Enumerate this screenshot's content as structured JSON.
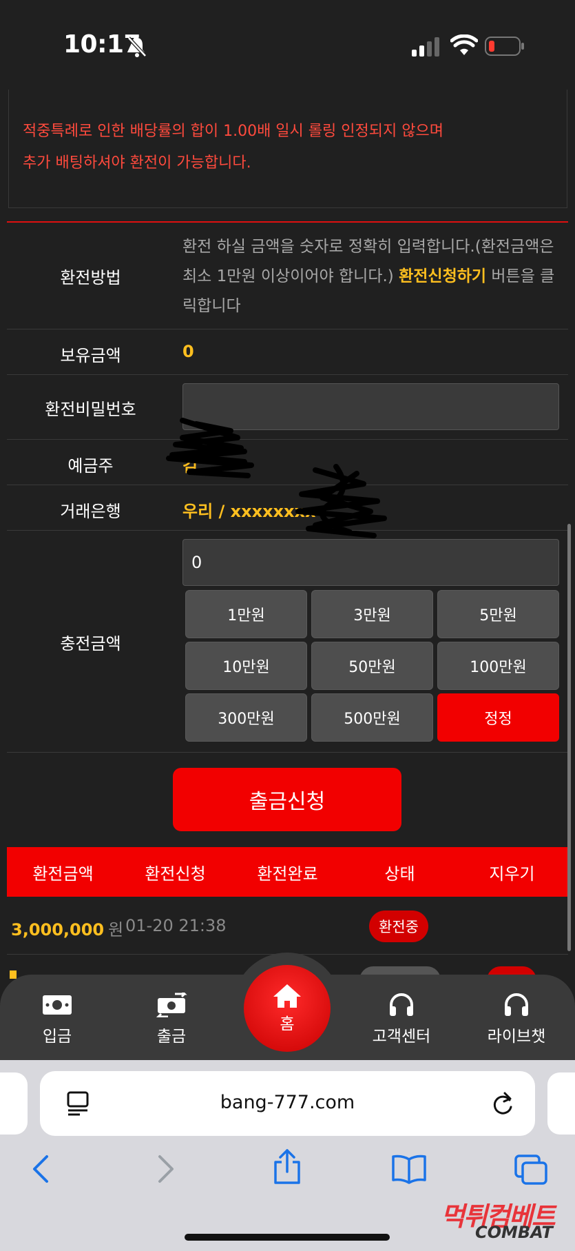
{
  "status_bar": {
    "time": "10:17"
  },
  "notice": {
    "line1": "적중특례로 인한 배당률의 합이 1.00배 일시 롤링 인정되지 않으며",
    "line2": "추가 배팅하셔야 환전이 가능합니다."
  },
  "form": {
    "method_label": "환전방법",
    "method_text_1": "환전 하실 금액을 숫자로 정확히 입력합니다.(환전금액은 최소 1만원 이상이어야 합니다.) ",
    "method_highlight": "환전신청하기",
    "method_text_2": " 버튼을 클릭합니다",
    "balance_label": "보유금액",
    "balance_value": "0",
    "password_label": "환전비밀번호",
    "password_value": "",
    "holder_label": "예금주",
    "holder_value": "김",
    "bank_label": "거래은행",
    "bank_value": "우리 / xxxxxxxx",
    "amount_label": "충전금액",
    "amount_value": "0",
    "amount_buttons": [
      "1만원",
      "3만원",
      "5만원",
      "10만원",
      "50만원",
      "100만원",
      "300만원",
      "500만원",
      "정정"
    ]
  },
  "withdraw_button": "출금신청",
  "history": {
    "headers": [
      "환전금액",
      "환전신청",
      "환전완료",
      "상태",
      "지우기"
    ],
    "rows": [
      {
        "amount": "3,000,000",
        "unit": "원",
        "requested": "01-20 21:38",
        "status": "환전중"
      }
    ]
  },
  "bottom_nav": {
    "deposit": "입금",
    "withdraw": "출금",
    "home": "홈",
    "support": "고객센터",
    "livechat": "라이브챗"
  },
  "browser": {
    "url": "bang-777.com"
  },
  "watermark": {
    "main": "먹튀컴베트",
    "sub": "COMBAT"
  },
  "colors": {
    "accent_red": "#f20000",
    "highlight_yellow": "#ffbf1f",
    "notice_red": "#ff4a3d",
    "background": "#202020"
  }
}
